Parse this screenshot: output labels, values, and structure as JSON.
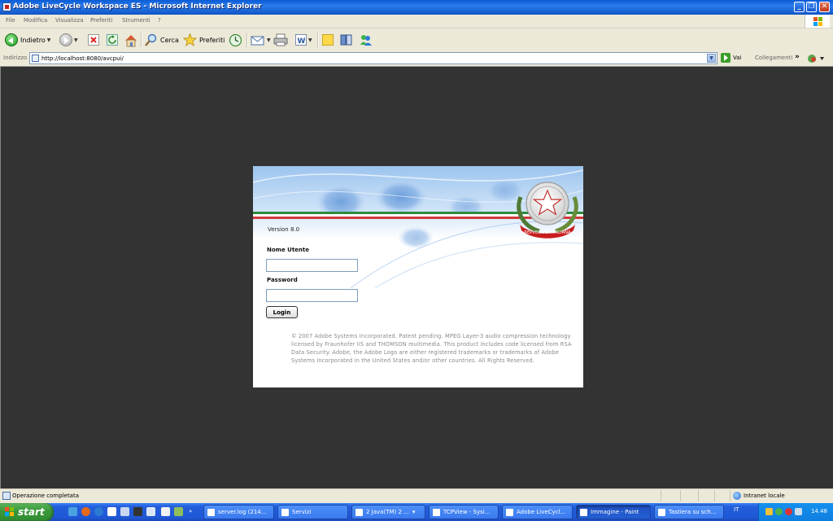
{
  "window": {
    "title": "Adobe LiveCycle Workspace ES - Microsoft Internet Explorer",
    "buttons": [
      "_",
      "❐",
      "✕"
    ]
  },
  "menu": [
    "File",
    "Modifica",
    "Visualizza",
    "Preferiti",
    "Strumenti",
    "?"
  ],
  "toolbar": {
    "back_label": "Indietro",
    "search_label": "Cerca",
    "favorites_label": "Preferiti"
  },
  "address": {
    "label": "Indirizzo",
    "url": "http://localhost:8080/avcpui/",
    "go_label": "Vai",
    "links_label": "Collegamenti",
    "more": "»"
  },
  "login": {
    "version": "Version 8.0",
    "username_label": "Nome Utente",
    "username_value": "",
    "password_label": "Password",
    "password_value": "",
    "button_label": "Login",
    "emblem_text": "REPVBBLICA ITALIANA",
    "copyright": "© 2007 Adobe Systems Incorporated. Patent pending. MPEG Layer-3 audio compression technology licensed by Fraunhofer IIS and THOMSON multimedia. This product includes code licensed from RSA Data Security. Adobe, the Adobe Logo are either registered trademarks or trademarks of Adobe Systems Incorporated in the United States and/or other countries. All Rights Reserved."
  },
  "status": {
    "text": "Operazione completata",
    "zone": "Intranet locale"
  },
  "taskbar": {
    "start": "start",
    "tasks": [
      "server.log (214...",
      "Servizi",
      "2 Java(TM) 2 ...",
      "TCPView - Sysi...",
      "Adobe LiveCycl...",
      "Immagine - Paint",
      "Tastiera su sch..."
    ],
    "language": "IT",
    "clock": "14.48"
  }
}
